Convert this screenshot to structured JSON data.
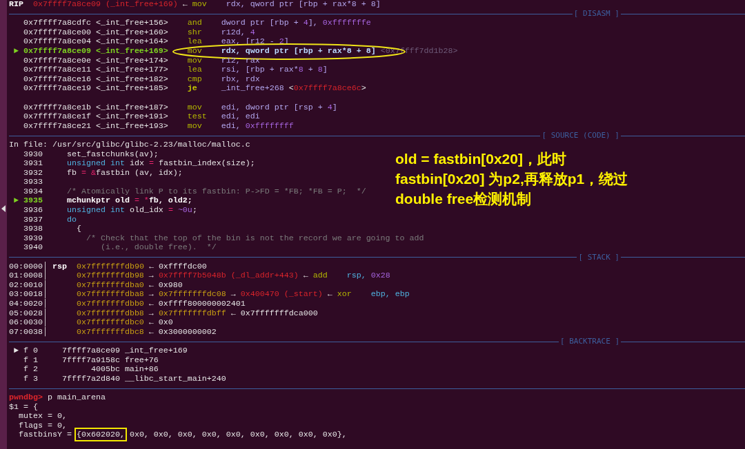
{
  "rip_line": [
    {
      "t": "RIP  ",
      "kind": "bold"
    },
    {
      "t": "0x7ffff7a8ce09 (_int_free+169)",
      "kind": "red"
    },
    {
      "t": " ← ",
      "kind": "plain"
    },
    {
      "t": "mov",
      "kind": "op"
    },
    {
      "t": "    rdx, qword ptr [rbp + rax*8 + 8]",
      "kind": "sym"
    }
  ],
  "panes": [
    {
      "header": "[ DISASM ]",
      "lines": [
        {
          "kind": "text",
          "circled": false,
          "segs": [
            {
              "t": "   0x7ffff7a8cdfc <_int_free+156>    ",
              "kind": "plain"
            },
            {
              "t": "and",
              "kind": "op"
            },
            {
              "t": "    dword ptr [rbp + ",
              "kind": "sym"
            },
            {
              "t": "4",
              "kind": "num"
            },
            {
              "t": "], ",
              "kind": "sym"
            },
            {
              "t": "0xfffffffe",
              "kind": "num"
            }
          ]
        },
        {
          "kind": "text",
          "circled": false,
          "segs": [
            {
              "t": "   0x7ffff7a8ce00 <_int_free+160>    ",
              "kind": "plain"
            },
            {
              "t": "shr",
              "kind": "op"
            },
            {
              "t": "    r12d, ",
              "kind": "sym"
            },
            {
              "t": "4",
              "kind": "num"
            }
          ]
        },
        {
          "kind": "text",
          "circled": false,
          "segs": [
            {
              "t": "   0x7ffff7a8ce04 <_int_free+164>    ",
              "kind": "plain"
            },
            {
              "t": "lea",
              "kind": "op"
            },
            {
              "t": "    eax, [r12 - ",
              "kind": "sym"
            },
            {
              "t": "2",
              "kind": "num"
            },
            {
              "t": "]",
              "kind": "sym"
            }
          ]
        },
        {
          "kind": "text",
          "circled": true,
          "segs": [
            {
              "t": " ►",
              "kind": "cur"
            },
            {
              "t": " 0x7ffff7a8ce09 <_int_free+169>    ",
              "kind": "cur"
            },
            {
              "t": "mov",
              "kind": "op"
            },
            {
              "t": "    rdx, qword ptr [rbp + rax*8 + 8]",
              "kind": "symb"
            },
            {
              "t": " <0x7ffff7dd1b28>",
              "kind": "dim"
            }
          ]
        },
        {
          "kind": "text",
          "circled": false,
          "segs": [
            {
              "t": "   0x7ffff7a8ce0e <_int_free+174>    ",
              "kind": "plain"
            },
            {
              "t": "mov",
              "kind": "op"
            },
            {
              "t": "    r12, rax",
              "kind": "sym"
            }
          ]
        },
        {
          "kind": "text",
          "circled": false,
          "segs": [
            {
              "t": "   0x7ffff7a8ce11 <_int_free+177>    ",
              "kind": "plain"
            },
            {
              "t": "lea",
              "kind": "op"
            },
            {
              "t": "    rsi, [rbp + rax*",
              "kind": "sym"
            },
            {
              "t": "8",
              "kind": "num"
            },
            {
              "t": " + ",
              "kind": "sym"
            },
            {
              "t": "8",
              "kind": "num"
            },
            {
              "t": "]",
              "kind": "sym"
            }
          ]
        },
        {
          "kind": "text",
          "circled": false,
          "segs": [
            {
              "t": "   0x7ffff7a8ce16 <_int_free+182>    ",
              "kind": "plain"
            },
            {
              "t": "cmp",
              "kind": "op"
            },
            {
              "t": "    rbx, rdx",
              "kind": "sym"
            }
          ]
        },
        {
          "kind": "text",
          "circled": false,
          "segs": [
            {
              "t": "   0x7ffff7a8ce19 <_int_free+185>    ",
              "kind": "plain"
            },
            {
              "t": "je",
              "kind": "opb"
            },
            {
              "t": "     _int_free+268 ",
              "kind": "sym"
            },
            {
              "t": "<",
              "kind": "plain"
            },
            {
              "t": "0x7ffff7a8ce6c",
              "kind": "red"
            },
            {
              "t": ">",
              "kind": "plain"
            }
          ]
        },
        {
          "kind": "blank"
        },
        {
          "kind": "text",
          "circled": false,
          "segs": [
            {
              "t": "   0x7ffff7a8ce1b <_int_free+187>    ",
              "kind": "plain"
            },
            {
              "t": "mov",
              "kind": "op"
            },
            {
              "t": "    edi, dword ptr [rsp + ",
              "kind": "sym"
            },
            {
              "t": "4",
              "kind": "num"
            },
            {
              "t": "]",
              "kind": "sym"
            }
          ]
        },
        {
          "kind": "text",
          "circled": false,
          "segs": [
            {
              "t": "   0x7ffff7a8ce1f <_int_free+191>    ",
              "kind": "plain"
            },
            {
              "t": "test",
              "kind": "op"
            },
            {
              "t": "   edi, edi",
              "kind": "sym"
            }
          ]
        },
        {
          "kind": "text",
          "circled": false,
          "segs": [
            {
              "t": "   0x7ffff7a8ce21 <_int_free+193>    ",
              "kind": "plain"
            },
            {
              "t": "mov",
              "kind": "op"
            },
            {
              "t": "    edi, ",
              "kind": "sym"
            },
            {
              "t": "0xffffffff",
              "kind": "num"
            }
          ]
        }
      ]
    },
    {
      "header": "[ SOURCE (CODE) ]",
      "lines": [
        {
          "kind": "text",
          "segs": [
            {
              "t": "In file: /usr/src/glibc/glibc-2.23/malloc/malloc.c",
              "kind": "plain"
            }
          ]
        },
        {
          "kind": "text",
          "segs": [
            {
              "t": "   3930     set_fastchunks(av);",
              "kind": "plain"
            }
          ]
        },
        {
          "kind": "text",
          "segs": [
            {
              "t": "   3931     ",
              "kind": "plain"
            },
            {
              "t": "unsigned int",
              "kind": "cyan"
            },
            {
              "t": " idx ",
              "kind": "plain"
            },
            {
              "t": "=",
              "kind": "pink"
            },
            {
              "t": " fastbin_index(size);",
              "kind": "plain"
            }
          ]
        },
        {
          "kind": "text",
          "segs": [
            {
              "t": "   3932     fb ",
              "kind": "plain"
            },
            {
              "t": "= &",
              "kind": "pink"
            },
            {
              "t": "fastbin (av, idx);",
              "kind": "plain"
            }
          ]
        },
        {
          "kind": "text",
          "segs": [
            {
              "t": "   3933",
              "kind": "plain"
            }
          ]
        },
        {
          "kind": "text",
          "segs": [
            {
              "t": "   3934     ",
              "kind": "plain"
            },
            {
              "t": "/* Atomically link P to its fastbin: P->FD = *FB; *FB = P;  */",
              "kind": "comment"
            }
          ]
        },
        {
          "kind": "text",
          "segs": [
            {
              "t": " ► 3935",
              "kind": "cur"
            },
            {
              "t": "     mchunkptr old ",
              "kind": "bold"
            },
            {
              "t": "= *",
              "kind": "pink"
            },
            {
              "t": "fb, old2;",
              "kind": "bold"
            }
          ]
        },
        {
          "kind": "text",
          "segs": [
            {
              "t": "   3936     ",
              "kind": "plain"
            },
            {
              "t": "unsigned int",
              "kind": "cyan"
            },
            {
              "t": " old_idx ",
              "kind": "plain"
            },
            {
              "t": "= ",
              "kind": "pink"
            },
            {
              "t": "~0u",
              "kind": "num"
            },
            {
              "t": ";",
              "kind": "plain"
            }
          ]
        },
        {
          "kind": "text",
          "segs": [
            {
              "t": "   3937     ",
              "kind": "plain"
            },
            {
              "t": "do",
              "kind": "cyan"
            }
          ]
        },
        {
          "kind": "text",
          "segs": [
            {
              "t": "   3938       {",
              "kind": "plain"
            }
          ]
        },
        {
          "kind": "text",
          "segs": [
            {
              "t": "   3939         ",
              "kind": "plain"
            },
            {
              "t": "/* Check that the top of the bin is not the record we are going to add",
              "kind": "comment"
            }
          ]
        },
        {
          "kind": "text",
          "segs": [
            {
              "t": "   3940            ",
              "kind": "plain"
            },
            {
              "t": "(i.e., double free).  */",
              "kind": "comment"
            }
          ]
        }
      ]
    },
    {
      "header": "[ STACK ]",
      "lines": [
        {
          "kind": "text",
          "segs": [
            {
              "t": "00:0000│ ",
              "kind": "plain"
            },
            {
              "t": "rsp  ",
              "kind": "bold"
            },
            {
              "t": "0x7fffffffdb90",
              "kind": "amber"
            },
            {
              "t": " ← 0xffffdc00",
              "kind": "plain"
            }
          ]
        },
        {
          "kind": "text",
          "segs": [
            {
              "t": "01:0008│      ",
              "kind": "plain"
            },
            {
              "t": "0x7fffffffdb98",
              "kind": "amber"
            },
            {
              "t": " → ",
              "kind": "plain"
            },
            {
              "t": "0x7ffff7b5048b (_dl_addr+443)",
              "kind": "red"
            },
            {
              "t": " ← ",
              "kind": "plain"
            },
            {
              "t": "add",
              "kind": "op"
            },
            {
              "t": "    rsp, ",
              "kind": "cyan"
            },
            {
              "t": "0x28",
              "kind": "num"
            }
          ]
        },
        {
          "kind": "text",
          "segs": [
            {
              "t": "02:0010│      ",
              "kind": "plain"
            },
            {
              "t": "0x7fffffffdba0",
              "kind": "amber"
            },
            {
              "t": " ← 0x980",
              "kind": "plain"
            }
          ]
        },
        {
          "kind": "text",
          "segs": [
            {
              "t": "03:0018│      ",
              "kind": "plain"
            },
            {
              "t": "0x7fffffffdba8",
              "kind": "amber"
            },
            {
              "t": " → ",
              "kind": "plain"
            },
            {
              "t": "0x7fffffffdc08",
              "kind": "amber"
            },
            {
              "t": " → ",
              "kind": "plain"
            },
            {
              "t": "0x400470 (_start)",
              "kind": "red"
            },
            {
              "t": " ← ",
              "kind": "plain"
            },
            {
              "t": "xor",
              "kind": "op"
            },
            {
              "t": "    ebp, ebp",
              "kind": "cyan"
            }
          ]
        },
        {
          "kind": "text",
          "segs": [
            {
              "t": "04:0020│      ",
              "kind": "plain"
            },
            {
              "t": "0x7fffffffdbb0",
              "kind": "amber"
            },
            {
              "t": " ← 0xffff800000002401",
              "kind": "plain"
            }
          ]
        },
        {
          "kind": "text",
          "segs": [
            {
              "t": "05:0028│      ",
              "kind": "plain"
            },
            {
              "t": "0x7fffffffdbb8",
              "kind": "amber"
            },
            {
              "t": " → ",
              "kind": "plain"
            },
            {
              "t": "0x7fffffffdbff",
              "kind": "amber"
            },
            {
              "t": " ← 0x7fffffffdca000",
              "kind": "plain"
            }
          ]
        },
        {
          "kind": "text",
          "segs": [
            {
              "t": "06:0030│      ",
              "kind": "plain"
            },
            {
              "t": "0x7fffffffdbc0",
              "kind": "amber"
            },
            {
              "t": " ← 0x0",
              "kind": "plain"
            }
          ]
        },
        {
          "kind": "text",
          "segs": [
            {
              "t": "07:0038│      ",
              "kind": "plain"
            },
            {
              "t": "0x7fffffffdbc8",
              "kind": "amber"
            },
            {
              "t": " ← 0x3000000002",
              "kind": "plain"
            }
          ]
        }
      ]
    },
    {
      "header": "[ BACKTRACE ]",
      "lines": [
        {
          "kind": "text",
          "segs": [
            {
              "t": " ► f 0     7ffff7a8ce09 _int_free+169",
              "kind": "plain"
            }
          ]
        },
        {
          "kind": "text",
          "segs": [
            {
              "t": "   f 1     7ffff7a9158c free+76",
              "kind": "plain"
            }
          ]
        },
        {
          "kind": "text",
          "segs": [
            {
              "t": "   f 2           4005bc main+86",
              "kind": "plain"
            }
          ]
        },
        {
          "kind": "text",
          "segs": [
            {
              "t": "   f 3     7ffff7a2d840 __libc_start_main+240",
              "kind": "plain"
            }
          ]
        }
      ]
    }
  ],
  "console": [
    {
      "kind": "text",
      "segs": [
        {
          "t": "pwndbg>",
          "kind": "prompt"
        },
        {
          "t": " p main_arena",
          "kind": "plain"
        }
      ]
    },
    {
      "kind": "text",
      "segs": [
        {
          "t": "$1 = {",
          "kind": "plain"
        }
      ]
    },
    {
      "kind": "text",
      "segs": [
        {
          "t": "  mutex = 0,",
          "kind": "plain"
        }
      ]
    },
    {
      "kind": "text",
      "segs": [
        {
          "t": "  flags = 0,",
          "kind": "plain"
        }
      ]
    },
    {
      "kind": "text",
      "segs": [
        {
          "t": "  fastbinsY = ",
          "kind": "plain"
        },
        {
          "t": "{0x602020,",
          "kind": "boxed"
        },
        {
          "t": " 0x0, 0x0, 0x0, 0x0, 0x0, 0x0, 0x0, 0x0, 0x0},",
          "kind": "plain"
        }
      ]
    }
  ],
  "annotation": [
    "old = fastbin[0x20]，此时",
    "fastbin[0x20] 为p2,再释放p1，绕过",
    "double free检测机制"
  ]
}
